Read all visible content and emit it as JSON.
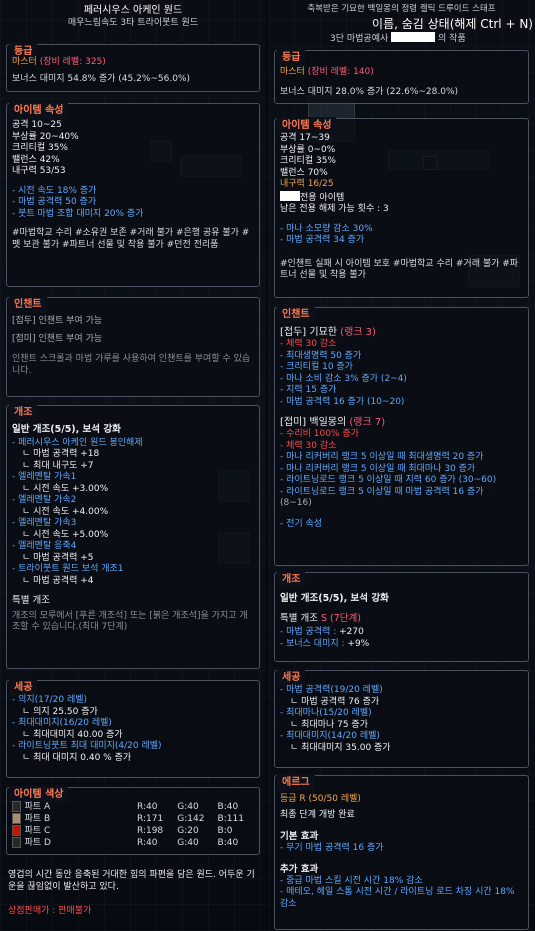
{
  "left": {
    "header": {
      "title": "페러시우스 아케인 원드",
      "subtitle": "매우느림속도 3타 트라이붓트 원드"
    },
    "grade": {
      "title": "등급",
      "rank": "마스터",
      "level_req": "(장비 레벨: 325)",
      "bonus": "보너스 대미지 54.8% 증가 (45.2%~56.0%)"
    },
    "props": {
      "title": "아이템 속성",
      "stats": [
        "공격 10~25",
        "부상률 20~40%",
        "크리티컬 35%",
        "밸런스 42%",
        "내구력 53/53"
      ],
      "effects": [
        "- 시전 속도 18% 증가",
        "- 마법 공격력 50 증가",
        "- 붓트 마법 조합 대미지 20% 증가"
      ],
      "tags": "#마법학교 수리  #소유권 보존  #거래 불가  #은행 공유 불가  #펫 보관 불가  #파트너 선물 및 착용 불가  #던전 전리품"
    },
    "enchant": {
      "title": "인챈트",
      "prefix": "[접두] 인챈트 부여 가능",
      "suffix": "[접미] 인챈트 부여 가능",
      "note": "인챈트 스크롤과 마법 가루를 사용하여 인챈트를 부여할 수 있습니다."
    },
    "reforge": {
      "title": "개조",
      "general": "일반 개조(5/5), 보석 강화",
      "lines": [
        {
          "t": "- 페러시우스 아케인 원드 봉인해제",
          "c": "blue"
        },
        {
          "t": "ㄴ 마법 공격력 +18",
          "c": "white",
          "i": true
        },
        {
          "t": "ㄴ 최대 내구도 +7",
          "c": "white",
          "i": true
        },
        {
          "t": "- 엘레멘탈 가속1",
          "c": "blue"
        },
        {
          "t": "ㄴ 시전 속도 +3.00%",
          "c": "white",
          "i": true
        },
        {
          "t": "- 엘레멘탈 가속2",
          "c": "blue"
        },
        {
          "t": "ㄴ 시전 속도 +4.00%",
          "c": "white",
          "i": true
        },
        {
          "t": "- 엘레멘탈 가속3",
          "c": "blue"
        },
        {
          "t": "ㄴ 시전 속도 +5.00%",
          "c": "white",
          "i": true
        },
        {
          "t": "- 엘레멘탈 응축4",
          "c": "blue"
        },
        {
          "t": "ㄴ 마법 공격력 +5",
          "c": "white",
          "i": true
        },
        {
          "t": "- 트라이붓트 원드 보석 개조1",
          "c": "blue"
        },
        {
          "t": "ㄴ 마법 공격력 +4",
          "c": "white",
          "i": true
        }
      ],
      "special_title": "특별 개조",
      "special_note": "개조의 모루에서 [푸른 개조석] 또는 [붉은 개조석]을 가지고 개조할 수 있습니다.(최대 7단계)"
    },
    "craft": {
      "title": "세공",
      "lines": [
        {
          "t": "- 의지(17/20 레벨)",
          "c": "blue"
        },
        {
          "t": "ㄴ 의지 25.50 증가",
          "c": "white",
          "i": true
        },
        {
          "t": "- 최대대미지(16/20 레벨)",
          "c": "blue"
        },
        {
          "t": "ㄴ 최대대미지 40.00 증가",
          "c": "white",
          "i": true
        },
        {
          "t": "- 라이트닝붓트 최대 대미지(4/20 레벨)",
          "c": "blue"
        },
        {
          "t": "ㄴ 최대 대미지 0.40 % 증가",
          "c": "white",
          "i": true
        }
      ]
    },
    "colors": {
      "title": "아이템 색상",
      "parts": [
        {
          "name": "파트 A",
          "r": "R:40",
          "g": "G:40",
          "b": "B:40",
          "hex": "#282828"
        },
        {
          "name": "파트 B",
          "r": "R:171",
          "g": "G:142",
          "b": "B:111",
          "hex": "#ab8e6f"
        },
        {
          "name": "파트 C",
          "r": "R:198",
          "g": "G:20",
          "b": "B:0",
          "hex": "#c61400"
        },
        {
          "name": "파트 D",
          "r": "R:40",
          "g": "G:40",
          "b": "B:40",
          "hex": "#282828"
        }
      ]
    },
    "lore": "영겁의 시간 동안 응축된 거대한 힘의 파편을 담은 원드. 어두운 기운을 끊임없이 발산하고 있다.",
    "shop_label": "상점판매가 : ",
    "shop_value": "판매불가"
  },
  "right": {
    "header": {
      "line1": "축복받은 기묘한 백일몽의 정령 켈틱 드루이드 스태프",
      "line2": "이름, 숨김 상태(해제 Ctrl + N)",
      "line3_a": "3단 마법공예사",
      "line3_b": "의 작품"
    },
    "grade": {
      "title": "등급",
      "rank": "마스터",
      "level_req": "(장비 레벨: 140)",
      "bonus": "보너스 대미지 28.0% 증가 (22.6%~28.0%)"
    },
    "props": {
      "title": "아이템 속성",
      "stats": [
        "공격 17~39",
        "부상률 0~0%",
        "크리티컬 35%",
        "밸런스 70%",
        "내구력 16/25"
      ],
      "exclusive": "전용 아이템",
      "remaining": "남은 전용 해제 가능 횟수 : 3",
      "effects": [
        "- 마나 소모량 감소 30%",
        "- 마법 공격력 34 증가"
      ],
      "tags": "#인챈트 실패 시 아이템 보호  #마법학교 수리  #거래 불가  #파트너 선물 및 착용 불가"
    },
    "enchant": {
      "title": "인챈트",
      "prefix_head": "[접두] 기묘한",
      "prefix_rank": "(랭크 3)",
      "prefix_lines": [
        {
          "t": "- 체력 30 감소",
          "c": "red"
        },
        {
          "t": "- 최대생명력 50 증가",
          "c": "blue"
        },
        {
          "t": "- 크리티컬 10 증가",
          "c": "blue"
        },
        {
          "t": "- 마나 소비 감소 3% 증가 (2~4)",
          "c": "blue"
        },
        {
          "t": "- 지력 15 증가",
          "c": "blue"
        },
        {
          "t": "- 마법 공격력 16 증가 (10~20)",
          "c": "blue"
        }
      ],
      "suffix_head": "[접미] 백일몽의",
      "suffix_rank": "(랭크 7)",
      "suffix_lines": [
        {
          "t": "- 수리비 100% 증가",
          "c": "red"
        },
        {
          "t": "- 체력 30 감소",
          "c": "red"
        },
        {
          "t": "- 마나 리커버리 랭크 5 이상일 때 최대생명력 20 증가",
          "c": "blue"
        },
        {
          "t": "- 마나 리커버리 랭크 5 이상일 때 최대마나 30 증가",
          "c": "blue"
        },
        {
          "t": "- 라이트닝로드 랭크 5 이상일 때 지력 60 증가 (30~60)",
          "c": "blue"
        },
        {
          "t": "- 라이트닝로드 랭크 5 이상일 때 마법 공격력 16 증가",
          "c": "blue"
        },
        {
          "t": "(8~16)",
          "c": "gray"
        }
      ],
      "element": "- 전기 속성"
    },
    "reforge": {
      "title": "개조",
      "general": "일반 개조(5/5), 보석 강화",
      "special_label": "특별 개조 ",
      "special_value": "S (7단계)",
      "lines": [
        {
          "k": "- 마법 공격력 : ",
          "v": "+270"
        },
        {
          "k": "- 보너스 대미지 : ",
          "v": "+9%"
        }
      ]
    },
    "craft": {
      "title": "세공",
      "lines": [
        {
          "t": "- 마법 공격력(19/20 레벨)",
          "c": "blue"
        },
        {
          "t": "ㄴ 마법 공격력 76 증가",
          "c": "white",
          "i": true
        },
        {
          "t": "- 최대마나(15/20 레벨)",
          "c": "blue"
        },
        {
          "t": "ㄴ 최대마나 75 증가",
          "c": "white",
          "i": true
        },
        {
          "t": "- 최대대미지(14/20 레벨)",
          "c": "blue"
        },
        {
          "t": "ㄴ 최대대미지 35.00 증가",
          "c": "white",
          "i": true
        }
      ]
    },
    "erg": {
      "title": "에르그",
      "grade_label": "등급 R (50/50 레벨)",
      "final": "최종 단계 개방 완료",
      "basic_title": "기본 효과",
      "basic": "- 무기 마법 공격력 16 증가",
      "extra_title": "추가 효과",
      "extra": [
        "- 중급 마법 스킬 시전 시간 18% 감소",
        "- 메테오, 헤일 스톰 시전 시간 / 라이트닝 로드 차징 시간 18% 감소"
      ]
    }
  }
}
